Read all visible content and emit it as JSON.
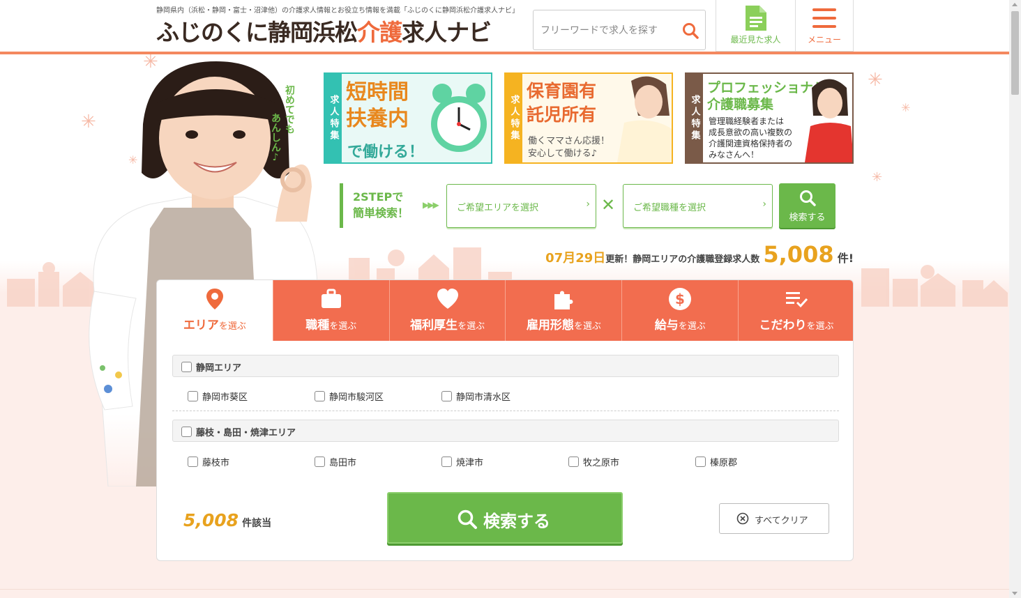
{
  "header": {
    "tagline": "静岡県内（浜松・静岡・富士・沼津他）の介護求人情報とお役立ち情報を満載「ふじのくに静岡浜松介護求人ナビ」",
    "logo_part1": "ふじのくに静岡浜松",
    "logo_accent": "介護",
    "logo_part2": "求人ナビ",
    "search_placeholder": "フリーワードで求人を探す",
    "recent_label": "最近見た求人",
    "menu_label": "メニュー"
  },
  "hero": {
    "hand_note_col1": "初めてでも",
    "hand_note_col2": "あんしん♪"
  },
  "banners": [
    {
      "side": "求人特集",
      "title_l1": "短時間",
      "title_l2": "扶養内",
      "sub": "で働ける！"
    },
    {
      "side": "求人特集",
      "title_l1": "保育園有",
      "title_l2": "託児所有",
      "sub_l1": "働くママさん応援！",
      "sub_l2": "安心して働ける♪"
    },
    {
      "side": "求人特集",
      "title_l1": "プロフェッショナル",
      "title_l2": "介護職募集",
      "sub_l1": "管理職経験者または",
      "sub_l2": "成長意欲の高い複数の",
      "sub_l3": "介護関連資格保持者の",
      "sub_l4": "みなさんへ！"
    }
  ],
  "two_step": {
    "label_l1": "2STEPで",
    "label_l2": "簡単検索！",
    "arrows": "▶▶▶",
    "area_select": "ご希望エリアを選択",
    "job_select": "ご希望職種を選択",
    "times": "✕",
    "search_label": "検索する"
  },
  "update": {
    "date": "07月29日",
    "text": "更新！静岡エリアの介護職登録求人数",
    "count": "5,008",
    "unit": "件!"
  },
  "tabs": [
    {
      "main": "エリア",
      "suffix": "を選ぶ",
      "icon": "pin-icon",
      "active": true
    },
    {
      "main": "職種",
      "suffix": "を選ぶ",
      "icon": "briefcase-icon",
      "active": false
    },
    {
      "main": "福利厚生",
      "suffix": "を選ぶ",
      "icon": "heart-icon",
      "active": false
    },
    {
      "main": "雇用形態",
      "suffix": "を選ぶ",
      "icon": "puzzle-icon",
      "active": false
    },
    {
      "main": "給与",
      "suffix": "を選ぶ",
      "icon": "dollar-icon",
      "active": false
    },
    {
      "main": "こだわり",
      "suffix": "を選ぶ",
      "icon": "checklist-icon",
      "active": false
    }
  ],
  "groups": [
    {
      "name": "静岡エリア",
      "options": [
        "静岡市葵区",
        "静岡市駿河区",
        "静岡市清水区"
      ]
    },
    {
      "name": "藤枝・島田・焼津エリア",
      "options": [
        "藤枝市",
        "島田市",
        "焼津市",
        "牧之原市",
        "榛原郡"
      ]
    }
  ],
  "results": {
    "count": "5,008",
    "unit": "件該当",
    "search_label": "検索する",
    "clear_label": "すべてクリア"
  },
  "colors": {
    "accent_orange": "#f26d4f",
    "green": "#6bb84a",
    "gold": "#e8a21e"
  }
}
